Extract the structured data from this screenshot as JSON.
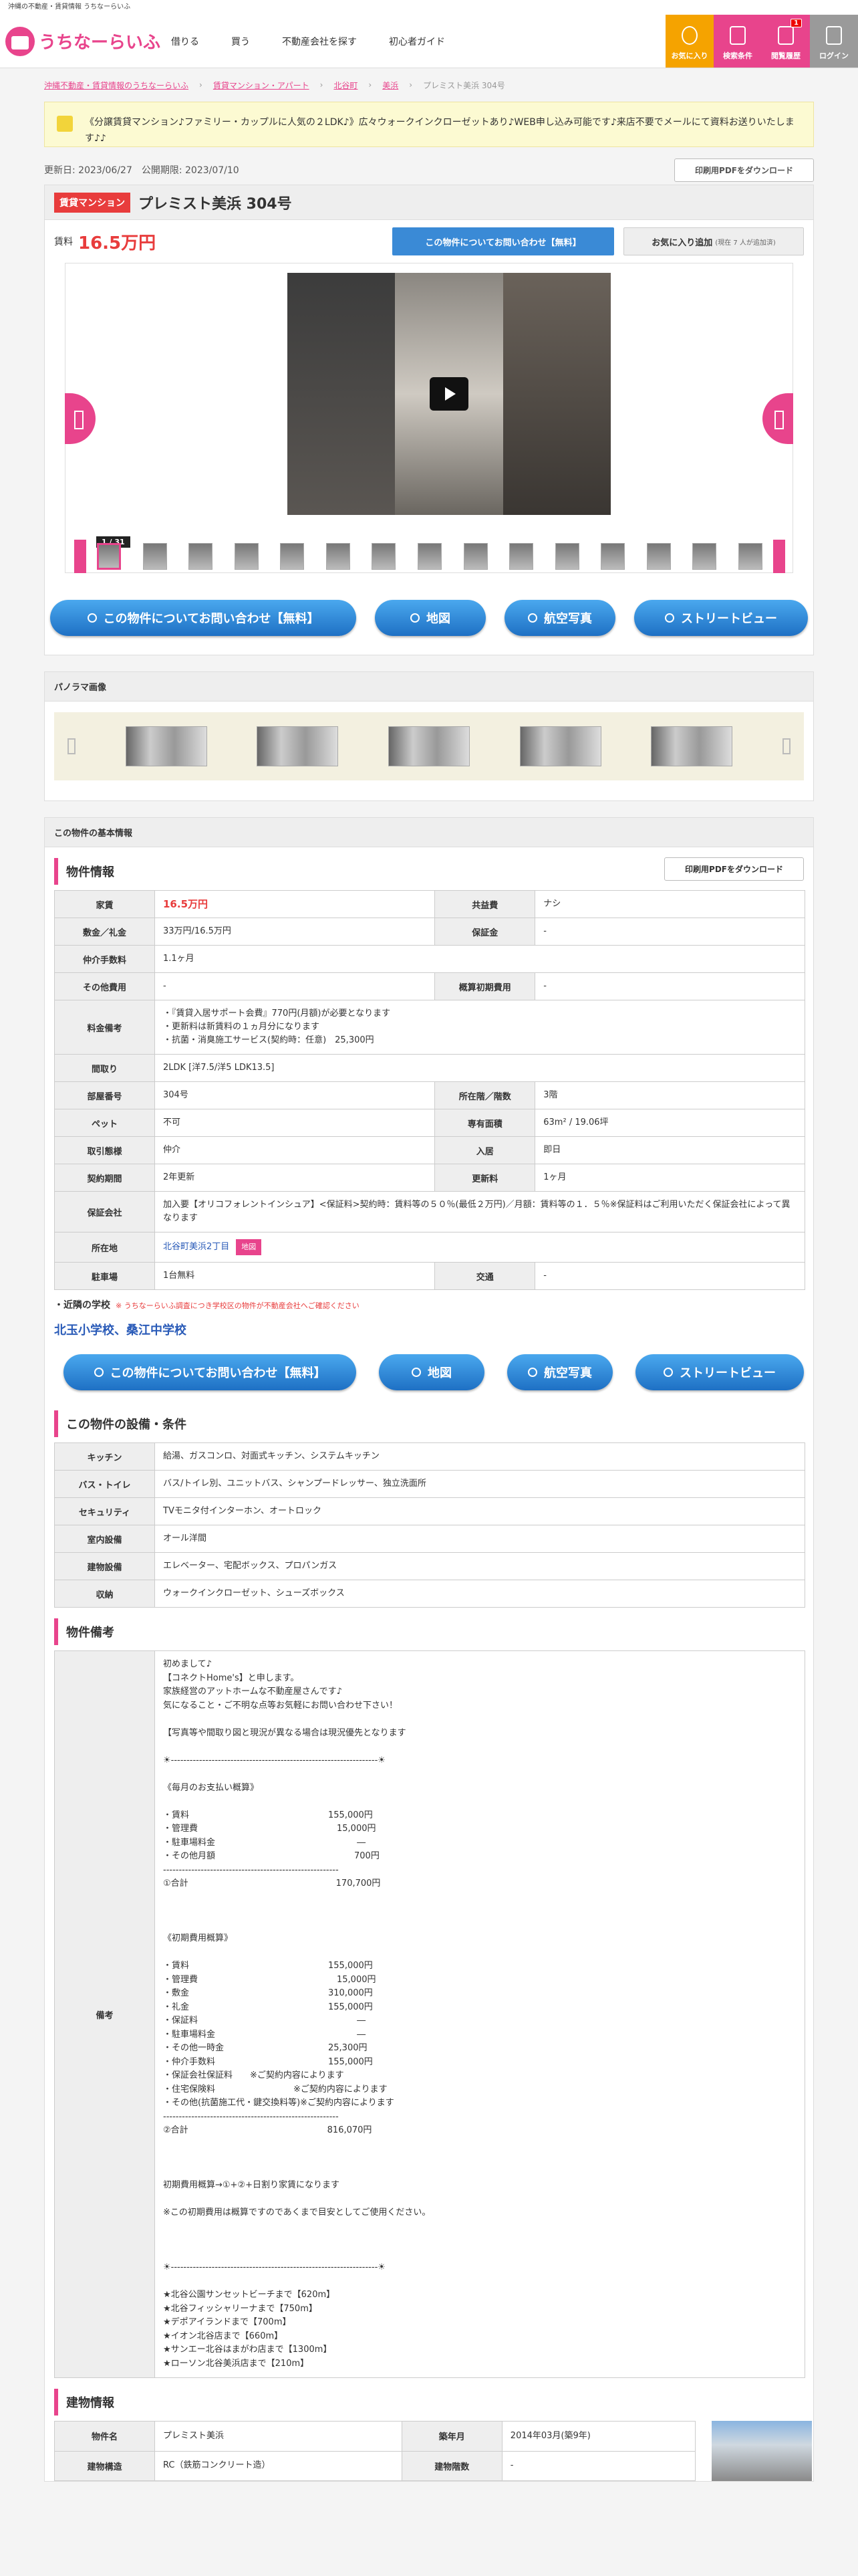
{
  "site_tagline": "沖縄の不動産・賃貸情報 うちなーらいふ",
  "logo_text": "うちなーらいふ",
  "nav": [
    "借りる",
    "買う",
    "不動産会社を探す",
    "初心者ガイド"
  ],
  "header_buttons": [
    {
      "label": "お気に入り",
      "color": "#f5a300"
    },
    {
      "label": "検索条件",
      "color": "#e8448c"
    },
    {
      "label": "閲覧履歴",
      "color": "#e8448c",
      "count": "1"
    },
    {
      "label": "ログイン",
      "color": "#9a9a9a"
    }
  ],
  "breadcrumb": [
    "沖縄不動産・賃貸情報のうちなーらいふ",
    "賃貸マンション・アパート",
    "北谷町",
    "美浜",
    "プレミスト美浜 304号"
  ],
  "notice": "《分譲賃貸マンション♪ファミリー・カップルに人気の２LDK♪》広々ウォークインクローゼットあり♪WEB申し込み可能です♪来店不要でメールにて資料お送りいたします♪♪",
  "updated": "更新日: 2023/06/27　公開期限: 2023/07/10",
  "pdf_button": "印刷用PDFをダウンロード",
  "property": {
    "badge": "賃貸マンション",
    "title": "プレミスト美浜 304号",
    "price_label": "賃料",
    "price": "16.5万円"
  },
  "inquiry_button": "この物件についてお問い合わせ【無料】",
  "fav_button": "お気に入り追加",
  "fav_note": "(現在 7 人が追加済)",
  "photo_counter": "1 / 31",
  "actions": [
    "この物件についてお問い合わせ【無料】",
    "地図",
    "航空写真",
    "ストリートビュー"
  ],
  "panorama_title": "パノラマ画像",
  "basic_title": "この物件の基本情報",
  "section_info": "物件情報",
  "info_rows": [
    [
      "家賃",
      "16.5万円",
      "共益費",
      "ナシ"
    ],
    [
      "敷金／礼金",
      "33万円/16.5万円",
      "保証金",
      "-"
    ],
    [
      "仲介手数料",
      "1.1ヶ月"
    ],
    [
      "その他費用",
      "-",
      "概算初期費用",
      "-"
    ],
    [
      "料金備考",
      "・『賃貸入居サポート会費』770円(月額)が必要となります\n・更新料は新賃料の１ヵ月分になります\n・抗菌・消臭施工サービス(契約時：任意)　25,300円"
    ],
    [
      "間取り",
      "2LDK [洋7.5/洋5 LDK13.5]"
    ],
    [
      "部屋番号",
      "304号",
      "所在階／階数",
      "3階"
    ],
    [
      "ペット",
      "不可",
      "専有面積",
      "63m² / 19.06坪"
    ],
    [
      "取引態様",
      "仲介",
      "入居",
      "即日"
    ],
    [
      "契約期間",
      "2年更新",
      "更新料",
      "1ヶ月"
    ],
    [
      "保証会社",
      "加入要【オリコフォレントインシュア】<保証料>契約時：賃料等の５０％(最低２万円)／月額：賃料等の１．５％※保証料はご利用いただく保証会社によって異なります"
    ],
    [
      "所在地",
      "北谷町美浜2丁目",
      "地図"
    ],
    [
      "駐車場",
      "1台無料",
      "交通",
      "-"
    ]
  ],
  "school_label": "・近隣の学校",
  "school_note": "※ うちなーらいふ調査につき学校区の物件が不動産会社へご確認ください",
  "schools": "北玉小学校、桑江中学校",
  "section_equipment": "この物件の設備・条件",
  "equipment": [
    [
      "キッチン",
      "給湯、ガスコンロ、対面式キッチン、システムキッチン"
    ],
    [
      "バス・トイレ",
      "バス/トイレ別、ユニットバス、シャンプードレッサー、独立洗面所"
    ],
    [
      "セキュリティ",
      "TVモニタ付インターホン、オートロック"
    ],
    [
      "室内設備",
      "オール洋間"
    ],
    [
      "建物設備",
      "エレベーター、宅配ボックス、プロパンガス"
    ],
    [
      "収納",
      "ウォークインクローゼット、シューズボックス"
    ]
  ],
  "section_remarks": "物件備考",
  "remarks_label": "備考",
  "remarks": "初めまして♪\n【コネクトHome's】と申します。\n家族経営のアットホームな不動産屋さんです♪\n気になること・ご不明な点等お気軽にお問い合わせ下さい！\n\n【写真等や間取り図と現況が異なる場合は現況優先となります\n\n☀------------------------------------------------------------------☀\n\n《毎月のお支払い概算》\n\n・賃料　　　　　　　　　　　　　　　　155,000円\n・管理費　　　　　　　　　　　　　　　　15,000円\n・駐車場料金　　　　　　　　　　　　　　　　 ―\n・その他月額　　　　　　　　　　　　　　　　700円\n--------------------------------------------------------\n①合計　　　　　　　　　　　　　　　　　170,700円\n\n\n\n《初期費用概算》\n\n・賃料　　　　　　　　　　　　　　　　155,000円\n・管理費　　　　　　　　　　　　　　　　15,000円\n・敷金　　　　　　　　　　　　　　　　310,000円\n・礼金　　　　　　　　　　　　　　　　155,000円\n・保証料　　　　　　　　　　　　　　　　　　 ―\n・駐車場料金　　　　　　　　　　　　　　　　 ―\n・その他一時金　　　　　　　　　　　　25,300円\n・仲介手数料　　　　　　　　　　　　　155,000円\n・保証会社保証料　　※ご契約内容によります\n・住宅保険料　　　　　　　　　※ご契約内容によります\n・その他(抗菌施工代・鍵交換料等)※ご契約内容によります\n--------------------------------------------------------\n②合計　　　　　　　　　　　　　　　　816,070円\n\n\n\n初期費用概算→①+②+日割り家賃になります\n\n※この初期費用は概算ですのであくまで目安としてご使用ください。\n\n\n\n☀------------------------------------------------------------------☀\n\n★北谷公園サンセットビーチまで【620m】\n★北谷フィッシャリーナまで【750m】\n★デポアイランドまで【700m】\n★イオン北谷店まで【660m】\n★サンエー北谷はまがわ店まで【1300m】\n★ローソン北谷美浜店まで【210m】",
  "section_building": "建物情報",
  "building": [
    [
      "物件名",
      "プレミスト美浜",
      "築年月",
      "2014年03月(築9年)"
    ],
    [
      "建物構造",
      "RC（鉄筋コンクリート造）",
      "建物階数",
      "-"
    ]
  ]
}
